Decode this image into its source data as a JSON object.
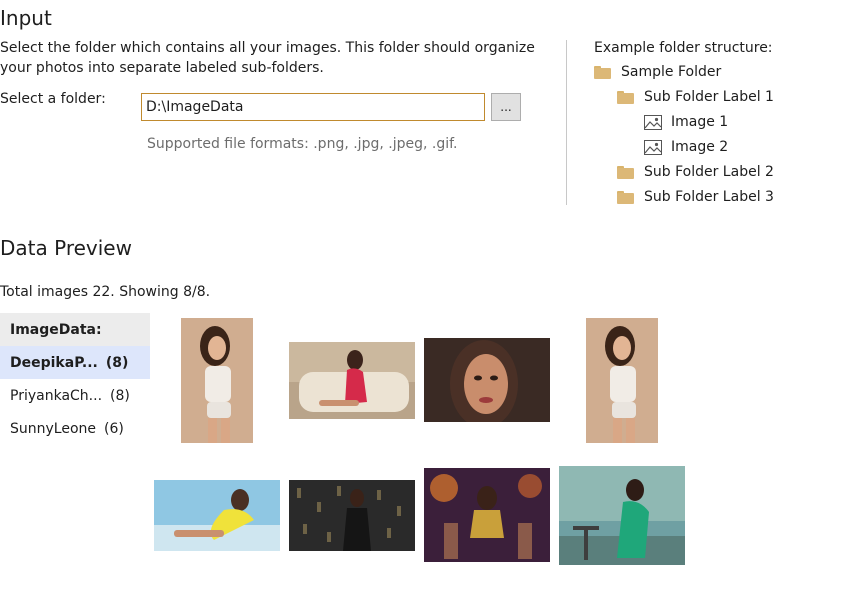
{
  "input": {
    "title": "Input",
    "description": "Select the folder which contains all your images. This folder should organize your photos into separate labeled sub-folders.",
    "folder_label": "Select a folder:",
    "folder_value": "D:\\ImageData",
    "browse_label": "...",
    "formats_note": "Supported file formats: .png, .jpg, .jpeg, .gif."
  },
  "example": {
    "title": "Example folder structure:",
    "items": [
      {
        "label": "Sample Folder",
        "icon": "folder-icon"
      },
      {
        "label": "Sub Folder Label 1",
        "icon": "folder-icon"
      },
      {
        "label": "Image 1",
        "icon": "image-icon"
      },
      {
        "label": "Image 2",
        "icon": "image-icon"
      },
      {
        "label": "Sub Folder Label 2",
        "icon": "folder-icon"
      },
      {
        "label": "Sub Folder Label 3",
        "icon": "folder-icon"
      }
    ]
  },
  "preview": {
    "title": "Data Preview",
    "total_text": "Total images 22. Showing 8/8.",
    "labels": {
      "header": "ImageData:",
      "items": [
        {
          "name": "DeepikaP...",
          "count": "(8)",
          "selected": true
        },
        {
          "name": "PriyankaCh...",
          "count": "(8)",
          "selected": false
        },
        {
          "name": "SunnyLeone",
          "count": "(6)",
          "selected": false
        }
      ]
    }
  },
  "colors": {
    "accent_border": "#c08a2e",
    "selected_row": "#dde6fb",
    "folder": "#dcb877"
  }
}
